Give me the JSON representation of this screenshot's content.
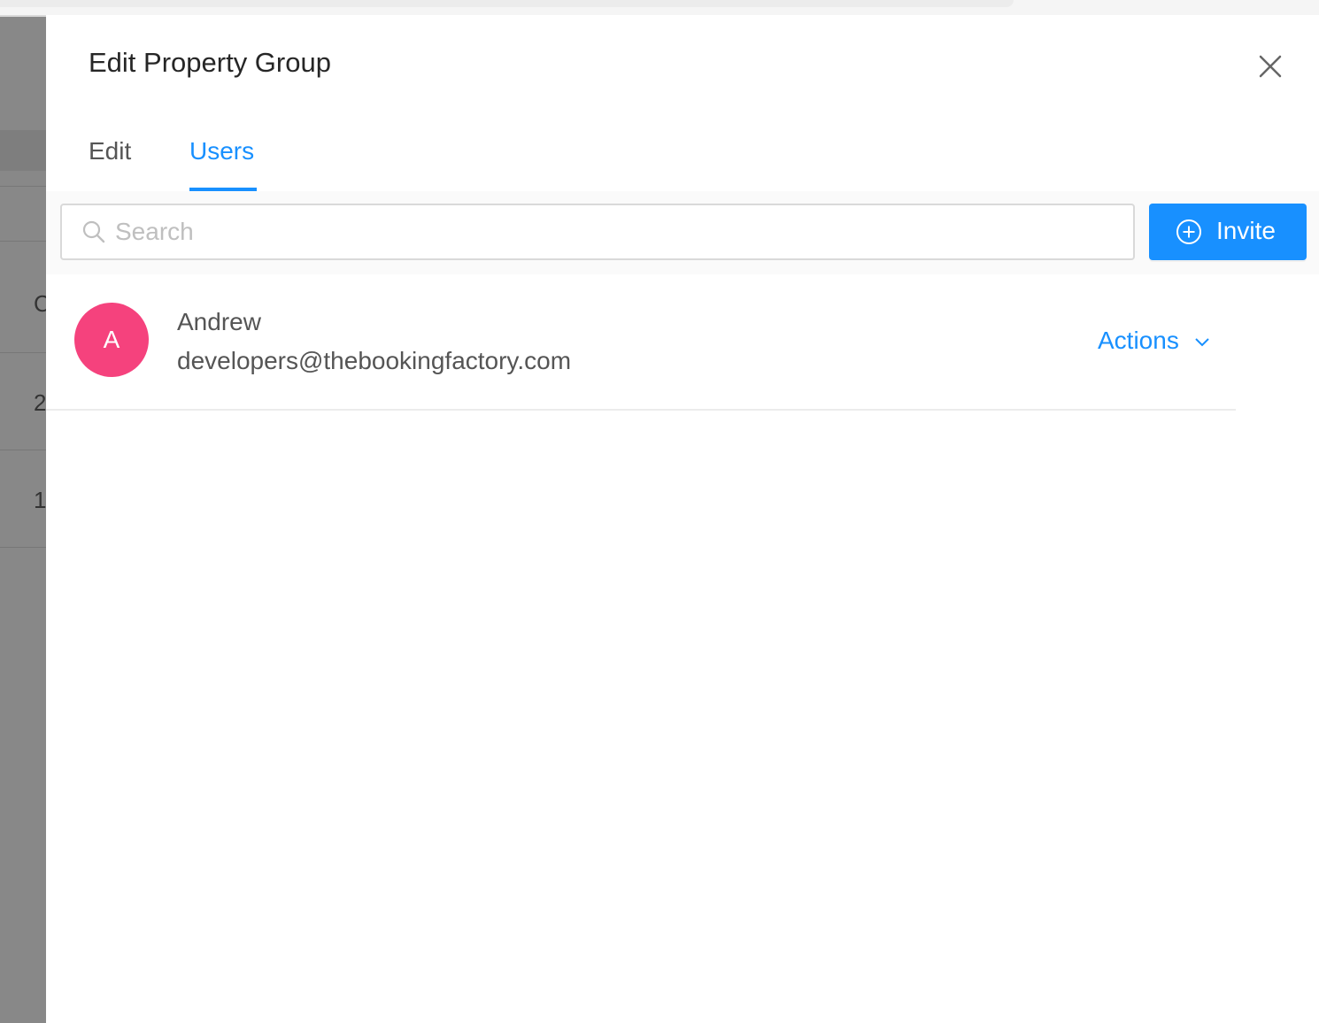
{
  "background": {
    "partial_chars": [
      "C",
      "2",
      "1"
    ]
  },
  "drawer": {
    "title": "Edit Property Group",
    "close_icon": "close-icon",
    "tabs": [
      {
        "label": "Edit",
        "active": false
      },
      {
        "label": "Users",
        "active": true
      }
    ],
    "search": {
      "placeholder": "Search",
      "icon": "search-icon"
    },
    "invite": {
      "label": "Invite",
      "icon": "plus-circle-icon"
    },
    "users": [
      {
        "initial": "A",
        "name": "Andrew",
        "email": "developers@thebookingfactory.com",
        "actions_label": "Actions",
        "avatar_color": "#f5427d"
      }
    ]
  },
  "colors": {
    "accent": "#1890ff",
    "avatar": "#f5427d"
  }
}
